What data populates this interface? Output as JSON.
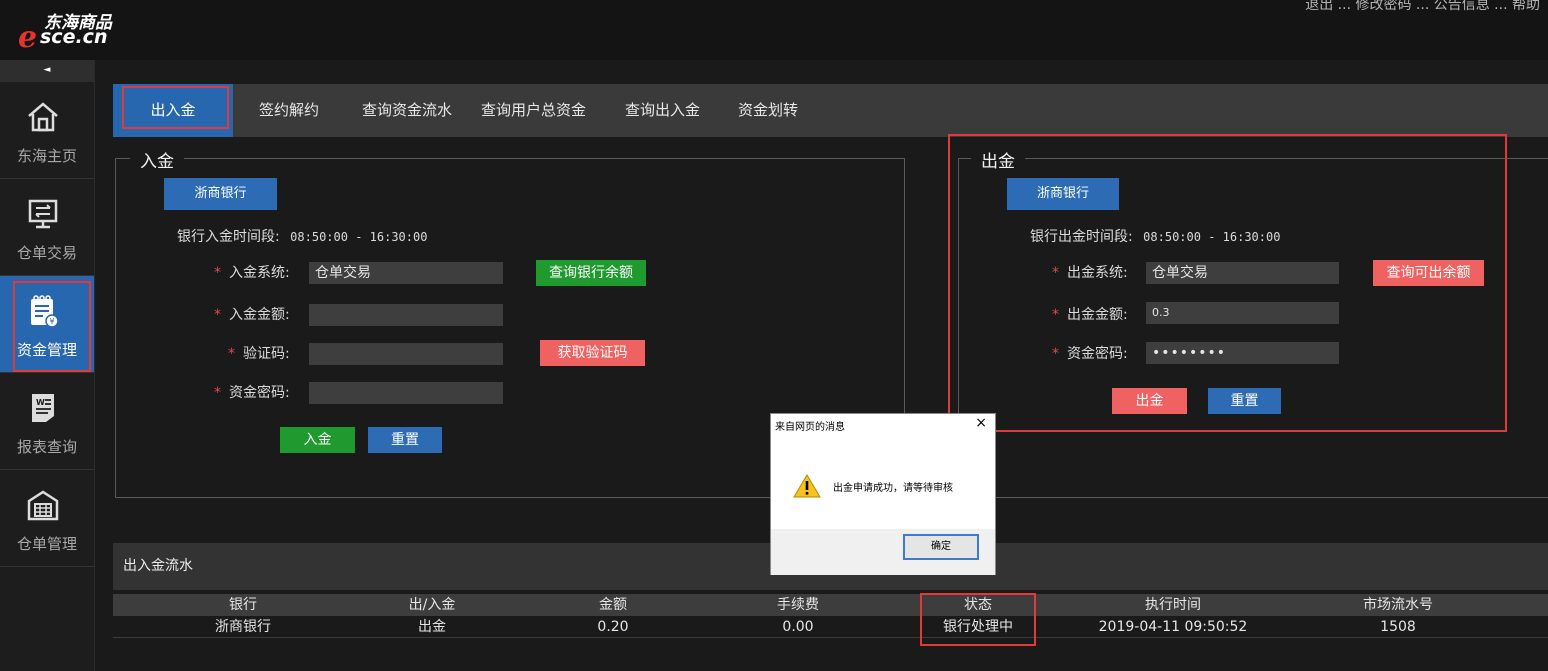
{
  "logo": {
    "brand_cn": "东海商品",
    "domain": "sce.cn",
    "letter": "e"
  },
  "top_links": "退出 ... 修改密码 ... 公告信息 ... 帮助",
  "sidebar": {
    "collapse": "◄",
    "items": [
      {
        "label": "东海主页",
        "icon": "home-icon"
      },
      {
        "label": "仓单交易",
        "icon": "trade-monitor-icon"
      },
      {
        "label": "资金管理",
        "icon": "fund-notebook-icon",
        "active": true
      },
      {
        "label": "报表查询",
        "icon": "report-doc-icon"
      },
      {
        "label": "仓单管理",
        "icon": "warehouse-icon"
      }
    ]
  },
  "tabs": [
    {
      "label": "出入金",
      "active": true
    },
    {
      "label": "签约解约"
    },
    {
      "label": "查询资金流水"
    },
    {
      "label": "查询用户总资金"
    },
    {
      "label": "查询出入金"
    },
    {
      "label": "资金划转"
    }
  ],
  "deposit": {
    "legend": "入金",
    "bank": "浙商银行",
    "time_label": "银行入金时间段:",
    "time_range": "08:50:00 - 16:30:00",
    "system_label": "入金系统:",
    "system_value": "仓单交易",
    "amount_label": "入金金额:",
    "amount_value": "",
    "code_label": "验证码:",
    "code_value": "",
    "password_label": "资金密码:",
    "password_value": "",
    "query_balance_btn": "查询银行余额",
    "get_code_btn": "获取验证码",
    "submit_btn": "入金",
    "reset_btn": "重置"
  },
  "withdraw": {
    "legend": "出金",
    "bank": "浙商银行",
    "time_label": "银行出金时间段:",
    "time_range": "08:50:00 - 16:30:00",
    "system_label": "出金系统:",
    "system_value": "仓单交易",
    "amount_label": "出金金额:",
    "amount_value": "0.3",
    "password_label": "资金密码:",
    "password_value": "••••••••",
    "query_btn": "查询可出余额",
    "submit_btn": "出金",
    "reset_btn": "重置"
  },
  "flow": {
    "title": "出入金流水",
    "headers": [
      "银行",
      "出/入金",
      "金额",
      "手续费",
      "状态",
      "执行时间",
      "市场流水号"
    ],
    "rows": [
      [
        "浙商银行",
        "出金",
        "0.20",
        "0.00",
        "银行处理中",
        "2019-04-11 09:50:52",
        "1508"
      ]
    ]
  },
  "dialog": {
    "title": "来自网页的消息",
    "close": "×",
    "message": "出金申请成功，请等待审核",
    "ok": "确定"
  },
  "colors": {
    "accent_blue": "#2767b0",
    "green": "#1e9a2e",
    "red": "#f06262",
    "highlight_red": "#e03a3a"
  }
}
